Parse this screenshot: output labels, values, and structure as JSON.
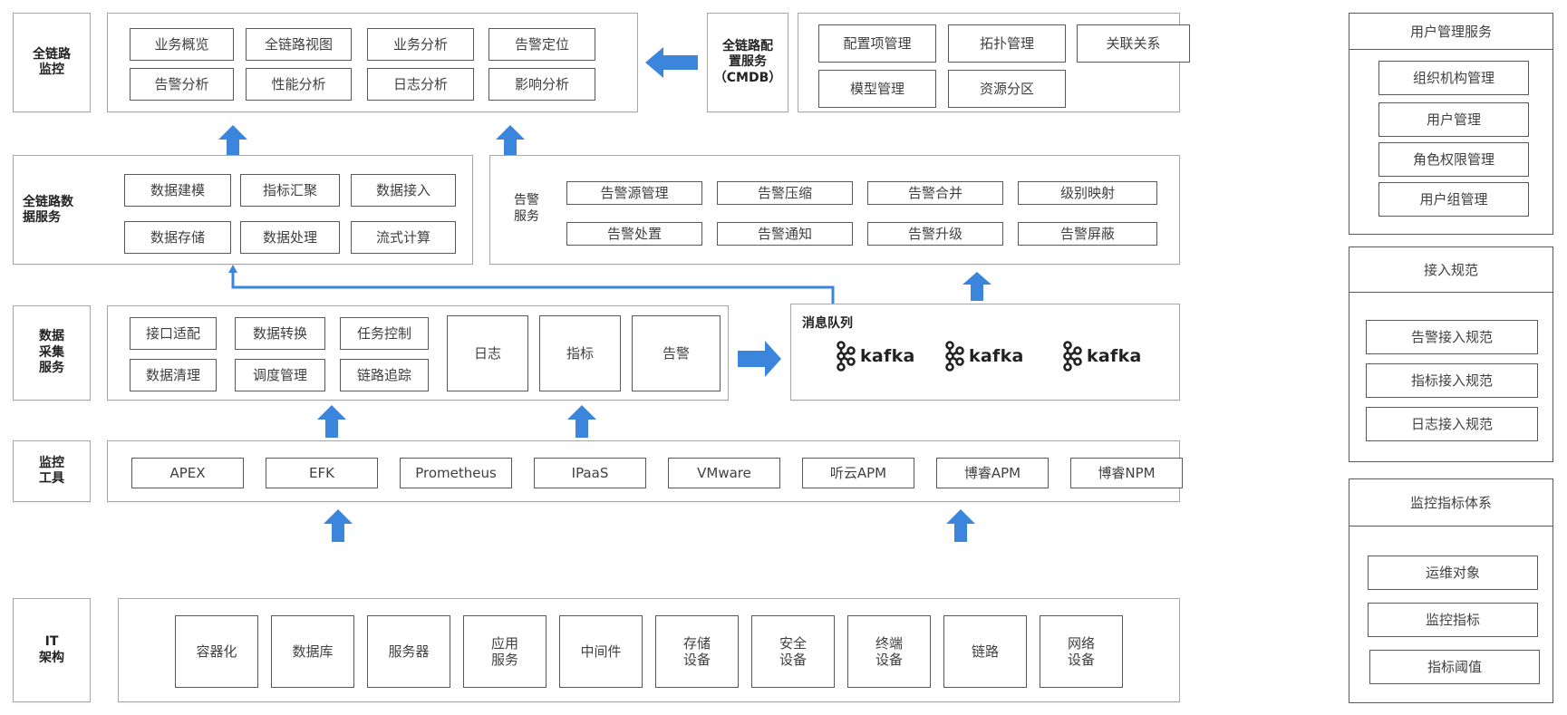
{
  "colors": {
    "arrow": "#3b86dc",
    "border": "#595959",
    "panel_border": "#a6a6a6"
  },
  "monitoring": {
    "label": "全链路\n监控",
    "items": [
      "业务概览",
      "全链路视图",
      "业务分析",
      "告警定位",
      "告警分析",
      "性能分析",
      "日志分析",
      "影响分析"
    ]
  },
  "cmdb": {
    "label": "全链路配\n置服务\n（CMDB）",
    "items": [
      "配置项管理",
      "拓扑管理",
      "关联关系",
      "模型管理",
      "资源分区"
    ]
  },
  "data_service": {
    "label": "全链路数\n据服务",
    "items": [
      "数据建模",
      "指标汇聚",
      "数据接入",
      "数据存储",
      "数据处理",
      "流式计算"
    ]
  },
  "alert_service": {
    "label": "告警\n服务",
    "items": [
      "告警源管理",
      "告警压缩",
      "告警合并",
      "级别映射",
      "告警处置",
      "告警通知",
      "告警升级",
      "告警屏蔽"
    ]
  },
  "collection": {
    "label": "数据\n采集\n服务",
    "items": [
      "接口适配",
      "数据转换",
      "任务控制",
      "数据清理",
      "调度管理",
      "链路追踪"
    ],
    "types": [
      "日志",
      "指标",
      "告警"
    ]
  },
  "mq": {
    "title": "消息队列",
    "brokers": [
      "kafka",
      "kafka",
      "kafka"
    ]
  },
  "tools": {
    "label": "监控\n工具",
    "items": [
      "APEX",
      "EFK",
      "Prometheus",
      "IPaaS",
      "VMware",
      "听云APM",
      "博睿APM",
      "博睿NPM"
    ]
  },
  "infra": {
    "label": "IT\n架构",
    "items": [
      "容器化",
      "数据库",
      "服务器",
      "应用\n服务",
      "中间件",
      "存储\n设备",
      "安全\n设备",
      "终端\n设备",
      "链路",
      "网络\n设备"
    ]
  },
  "user_mgmt": {
    "title": "用户管理服务",
    "items": [
      "组织机构管理",
      "用户管理",
      "角色权限管理",
      "用户组管理"
    ]
  },
  "access_spec": {
    "title": "接入规范",
    "items": [
      "告警接入规范",
      "指标接入规范",
      "日志接入规范"
    ]
  },
  "metric_system": {
    "title": "监控指标体系",
    "items": [
      "运维对象",
      "监控指标",
      "指标阈值"
    ]
  }
}
